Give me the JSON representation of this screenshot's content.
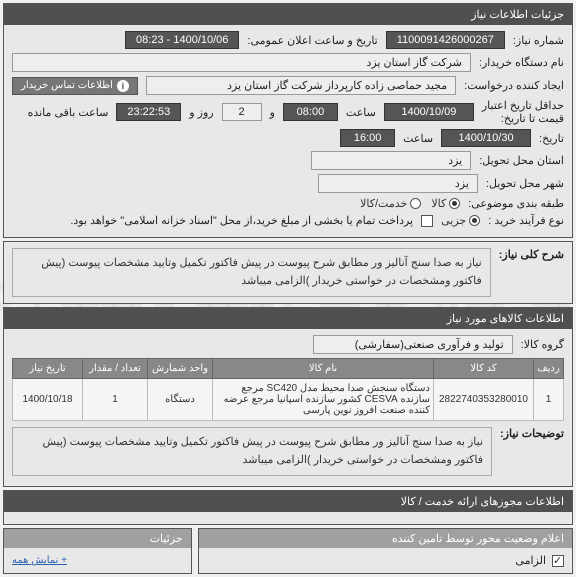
{
  "watermark_line1": "سامانه تدارکات الکترونیکی دولت",
  "panels": {
    "need_info": {
      "title": "جزئیات اطلاعات نیاز"
    },
    "general_desc": {
      "title": "شرح کلی نیاز:"
    },
    "items_info": {
      "title": "اطلاعات کالاهای مورد نیاز"
    },
    "permits": {
      "title": "اطلاعات مجوزهای ارائه خدمت / کالا"
    },
    "status_by_guarantor": {
      "title": "اعلام وضعیت محور توسط تامین کننده"
    },
    "details": {
      "title": "جزئیات"
    }
  },
  "fields": {
    "need_no_label": "شماره نیاز:",
    "need_no": "1100091426000267",
    "announce_dt_label": "تاریخ و ساعت اعلان عمومی:",
    "announce_dt": "1400/10/06 - 08:23",
    "buyer_org_label": "نام دستگاه خریدار:",
    "buyer_org": "شرکت گاز استان یزد",
    "requester_label": "ایجاد کننده درخواست:",
    "requester": "مجید حماصی زاده کارپرداز شرکت گاز استان یزد",
    "contact_btn": "اطلاعات تماس خریدار",
    "min_valid_label": "حداقل تاریخ اعتبار",
    "min_valid_sub": "قیمت تا تاریخ:",
    "min_valid_date": "1400/10/09",
    "time1_label": "ساعت",
    "time1": "08:00",
    "and_label": "و",
    "days_label": "روز و",
    "days": "2",
    "remain_label": "ساعت باقی مانده",
    "remain": "23:22:53",
    "date2_label": "تاریخ:",
    "date2": "1400/10/30",
    "time2_label": "ساعت",
    "time2": "16:00",
    "province_label": "استان محل تحویل:",
    "province": "یزد",
    "city_label": "شهر محل تحویل:",
    "city": "یزد",
    "category_label": "طبقه بندی موضوعی:",
    "cat_goods": "کالا",
    "cat_service": "خدمت/کالا",
    "process_label": "نوع فرآیند خرید :",
    "proc_single": "جزیی",
    "proc_note": "پرداخت تمام یا بخشی از مبلغ خرید،از محل \"اسناد خزانه اسلامی\" خواهد بود."
  },
  "general_desc_text": "نیاز به صدا سنج آنالیز ور مطابق شرح پیوست در پیش فاکتور تکمیل وتایید مشخصات پیوست (پیش فاکتور ومشخصات در خواستی خریدار )الزامی میباشد",
  "items": {
    "group_label": "گروه کالا:",
    "group_value": "تولید و فرآوری صنعتی(سفارشی)",
    "headers": {
      "row": "ردیف",
      "code": "کد کالا",
      "name": "نام کالا",
      "unit": "واحد شمارش",
      "qty": "تعداد / مقدار",
      "need_date": "تاریخ نیاز"
    },
    "rows": [
      {
        "row": "1",
        "code": "2822740353280010",
        "name": "دستگاه سنجش صدا محیط مدل SC420 مرجع سازنده CESVA کشور سازنده اسپانیا مرجع عرضه کننده صنعت افروز نوین پارسی",
        "unit": "دستگاه",
        "qty": "1",
        "need_date": "1400/10/18"
      }
    ],
    "notes_label": "توضیحات نیاز:",
    "notes_text": "نیاز به صدا سنج آنالیز ور مطابق شرح پیوست در پیش فاکتور تکمیل وتایید مشخصات پیوست (پیش فاکتور ومشخصات در خواستی خریدار )الزامی میباشد"
  },
  "bottom": {
    "mandatory": "الزامی",
    "details_link": "+ نمایش همه"
  }
}
